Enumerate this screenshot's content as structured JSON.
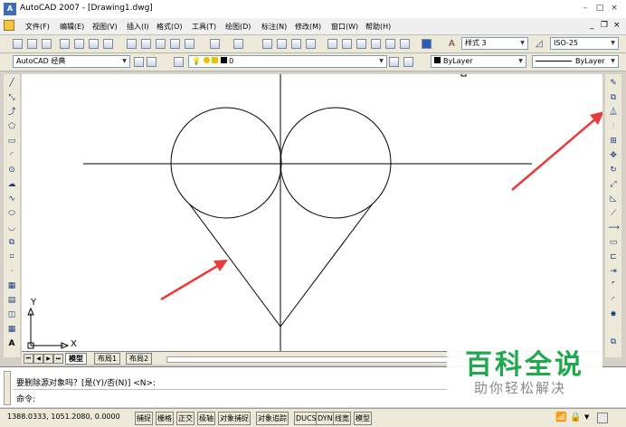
{
  "window": {
    "title": "AutoCAD 2007 - [Drawing1.dwg]",
    "logo_text": "A",
    "controls": {
      "minimize": "–",
      "maximize": "□",
      "close": "×"
    },
    "doc_controls": {
      "minimize": "_",
      "restore": "❐",
      "close": "×"
    }
  },
  "menu": [
    "文件(F)",
    "编辑(E)",
    "视图(V)",
    "插入(I)",
    "格式(O)",
    "工具(T)",
    "绘图(D)",
    "标注(N)",
    "修改(M)",
    "窗口(W)",
    "帮助(H)"
  ],
  "toolbar": {
    "text_style": "样式 3",
    "dim_style": "ISO-25",
    "workspace": "AutoCAD 经典",
    "layer": "0",
    "color": "ByLayer",
    "linetype": "ByLayer"
  },
  "ucs": {
    "x_label": "X",
    "y_label": "Y"
  },
  "tabs": {
    "model": "模型",
    "layout1": "布局1",
    "layout2": "布局2"
  },
  "command": {
    "history_line": "要删除源对象吗？[是(Y)/否(N)] <N>:",
    "prompt": "命令:"
  },
  "status": {
    "coords": "1388.0333, 1051.2080, 0.0000",
    "buttons": [
      "捕捉",
      "栅格",
      "正交",
      "极轴",
      "对象捕捉",
      "对象追踪",
      "DUCS",
      "DYN",
      "线宽",
      "模型"
    ]
  },
  "watermark": {
    "title": "百科全说",
    "subtitle": "助你轻松解决"
  },
  "colors": {
    "annotation_arrow": "#e83c3c",
    "watermark_green": "#1fa84d",
    "canvas": "#ffffff"
  }
}
